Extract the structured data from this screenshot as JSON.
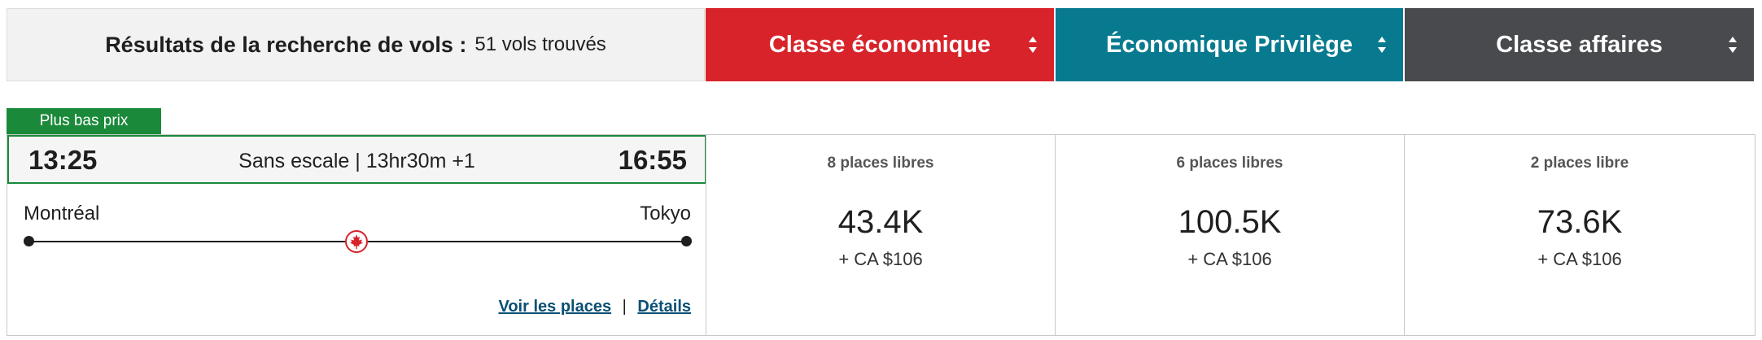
{
  "results": {
    "title": "Résultats de la recherche de vols :",
    "count": "51 vols trouvés"
  },
  "cabins": [
    {
      "label": "Classe économique",
      "color": "#d8232a",
      "sort_icon": "sort-icon"
    },
    {
      "label": "Économique Privilège",
      "color": "#087a8f",
      "sort_icon": "sort-icon"
    },
    {
      "label": "Classe affaires",
      "color": "#484a4d",
      "sort_icon": "sort-icon"
    }
  ],
  "flight": {
    "badge": "Plus bas prix",
    "badge_color": "#1a8a3a",
    "departure_time": "13:25",
    "arrival_time": "16:55",
    "info": "Sans escale | 13hr30m +1",
    "origin": "Montréal",
    "destination": "Tokyo",
    "airline_icon": "maple-leaf-icon",
    "links": {
      "seats": "Voir les places",
      "separator": "|",
      "details": "Détails"
    }
  },
  "fares": [
    {
      "seats": "8 places libres",
      "points": "43.4K",
      "fees": "+ CA $106"
    },
    {
      "seats": "6 places libres",
      "points": "100.5K",
      "fees": "+ CA $106"
    },
    {
      "seats": "2 places libre",
      "points": "73.6K",
      "fees": "+ CA $106"
    }
  ]
}
